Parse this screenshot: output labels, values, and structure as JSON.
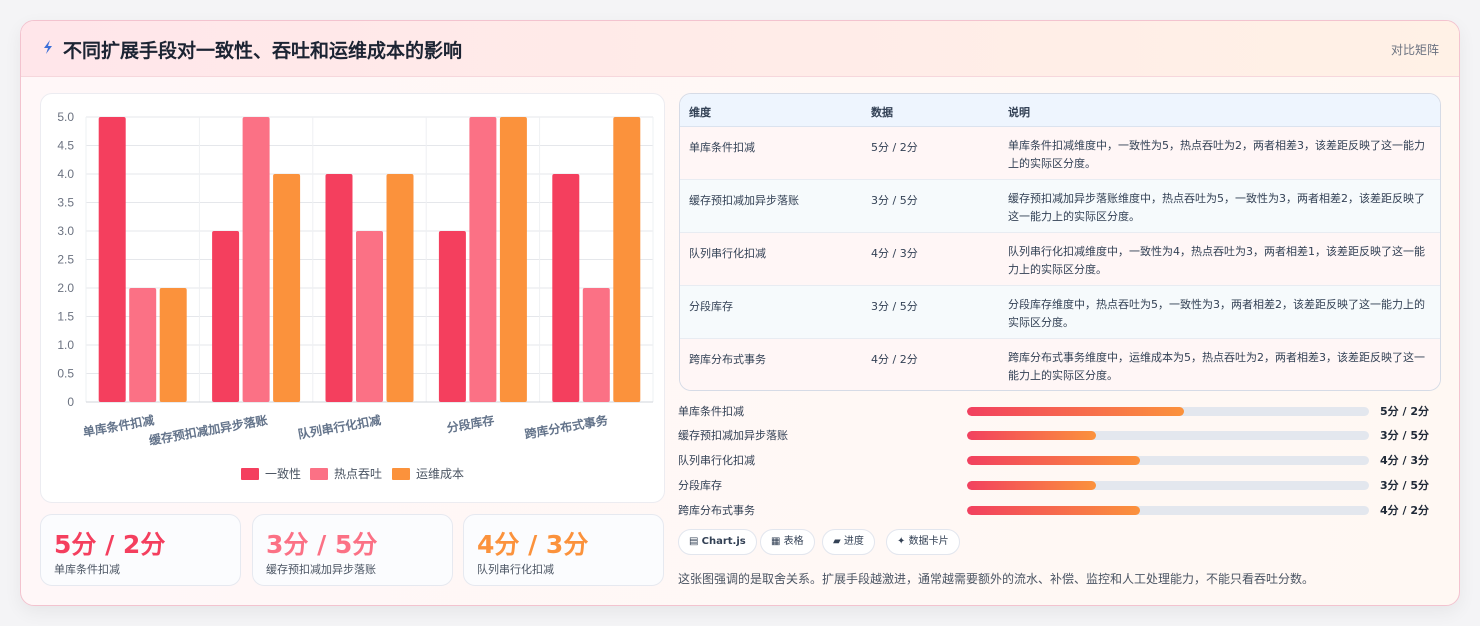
{
  "header": {
    "title": "不同扩展手段对一致性、吞吐和运维成本的影响",
    "tag": "对比矩阵"
  },
  "colors": {
    "consistency": "#f43f5e",
    "throughput": "#fb7185",
    "opscost": "#fb923c"
  },
  "chart_data": {
    "type": "bar",
    "categories": [
      "单库条件扣减",
      "缓存预扣减加异步落账",
      "队列串行化扣减",
      "分段库存",
      "跨库分布式事务"
    ],
    "series": [
      {
        "name": "一致性",
        "values": [
          5,
          3,
          4,
          3,
          4
        ]
      },
      {
        "name": "热点吞吐",
        "values": [
          2,
          5,
          3,
          5,
          2
        ]
      },
      {
        "name": "运维成本",
        "values": [
          2,
          4,
          4,
          5,
          5
        ]
      }
    ],
    "ylim": [
      0,
      5
    ],
    "yticks": [
      "0",
      "0.5",
      "1.0",
      "1.5",
      "2.0",
      "2.5",
      "3.0",
      "3.5",
      "4.0",
      "4.5",
      "5.0"
    ],
    "grid": true,
    "legend": "bottom"
  },
  "stats": [
    {
      "value": "5分 / 2分",
      "label": "单库条件扣减"
    },
    {
      "value": "3分 / 5分",
      "label": "缓存预扣减加异步落账"
    },
    {
      "value": "4分 / 3分",
      "label": "队列串行化扣减"
    }
  ],
  "table": {
    "headers": [
      "维度",
      "数据",
      "说明"
    ],
    "rows": [
      {
        "name": "单库条件扣减",
        "value": "5分 / 2分",
        "desc": "单库条件扣减维度中，一致性为5，热点吞吐为2，两者相差3，该差距反映了这一能力上的实际区分度。"
      },
      {
        "name": "缓存预扣减加异步落账",
        "value": "3分 / 5分",
        "desc": "缓存预扣减加异步落账维度中，热点吞吐为5，一致性为3，两者相差2，该差距反映了这一能力上的实际区分度。"
      },
      {
        "name": "队列串行化扣减",
        "value": "4分 / 3分",
        "desc": "队列串行化扣减维度中，一致性为4，热点吞吐为3，两者相差1，该差距反映了这一能力上的实际区分度。"
      },
      {
        "name": "分段库存",
        "value": "3分 / 5分",
        "desc": "分段库存维度中，热点吞吐为5，一致性为3，两者相差2，该差距反映了这一能力上的实际区分度。"
      },
      {
        "name": "跨库分布式事务",
        "value": "4分 / 2分",
        "desc": "跨库分布式事务维度中，运维成本为5，热点吞吐为2，两者相差3，该差距反映了这一能力上的实际区分度。"
      }
    ]
  },
  "progress": [
    {
      "label": "单库条件扣减",
      "value": "5分 / 2分",
      "fraction": 0.54
    },
    {
      "label": "缓存预扣减加异步落账",
      "value": "3分 / 5分",
      "fraction": 0.32
    },
    {
      "label": "队列串行化扣减",
      "value": "4分 / 3分",
      "fraction": 0.43
    },
    {
      "label": "分段库存",
      "value": "3分 / 5分",
      "fraction": 0.32
    },
    {
      "label": "跨库分布式事务",
      "value": "4分 / 2分",
      "fraction": 0.43
    }
  ],
  "chips": [
    {
      "icon": "chart-icon",
      "glyph": "▤",
      "label": "Chart.js"
    },
    {
      "icon": "table-icon",
      "glyph": "▦",
      "label": "表格"
    },
    {
      "icon": "progress-icon",
      "glyph": "▰",
      "label": "进度"
    },
    {
      "icon": "sparkle-icon",
      "glyph": "✦",
      "label": "数据卡片"
    }
  ],
  "note": "这张图强调的是取舍关系。扩展手段越激进，通常越需要额外的流水、补偿、监控和人工处理能力，不能只看吞吐分数。"
}
